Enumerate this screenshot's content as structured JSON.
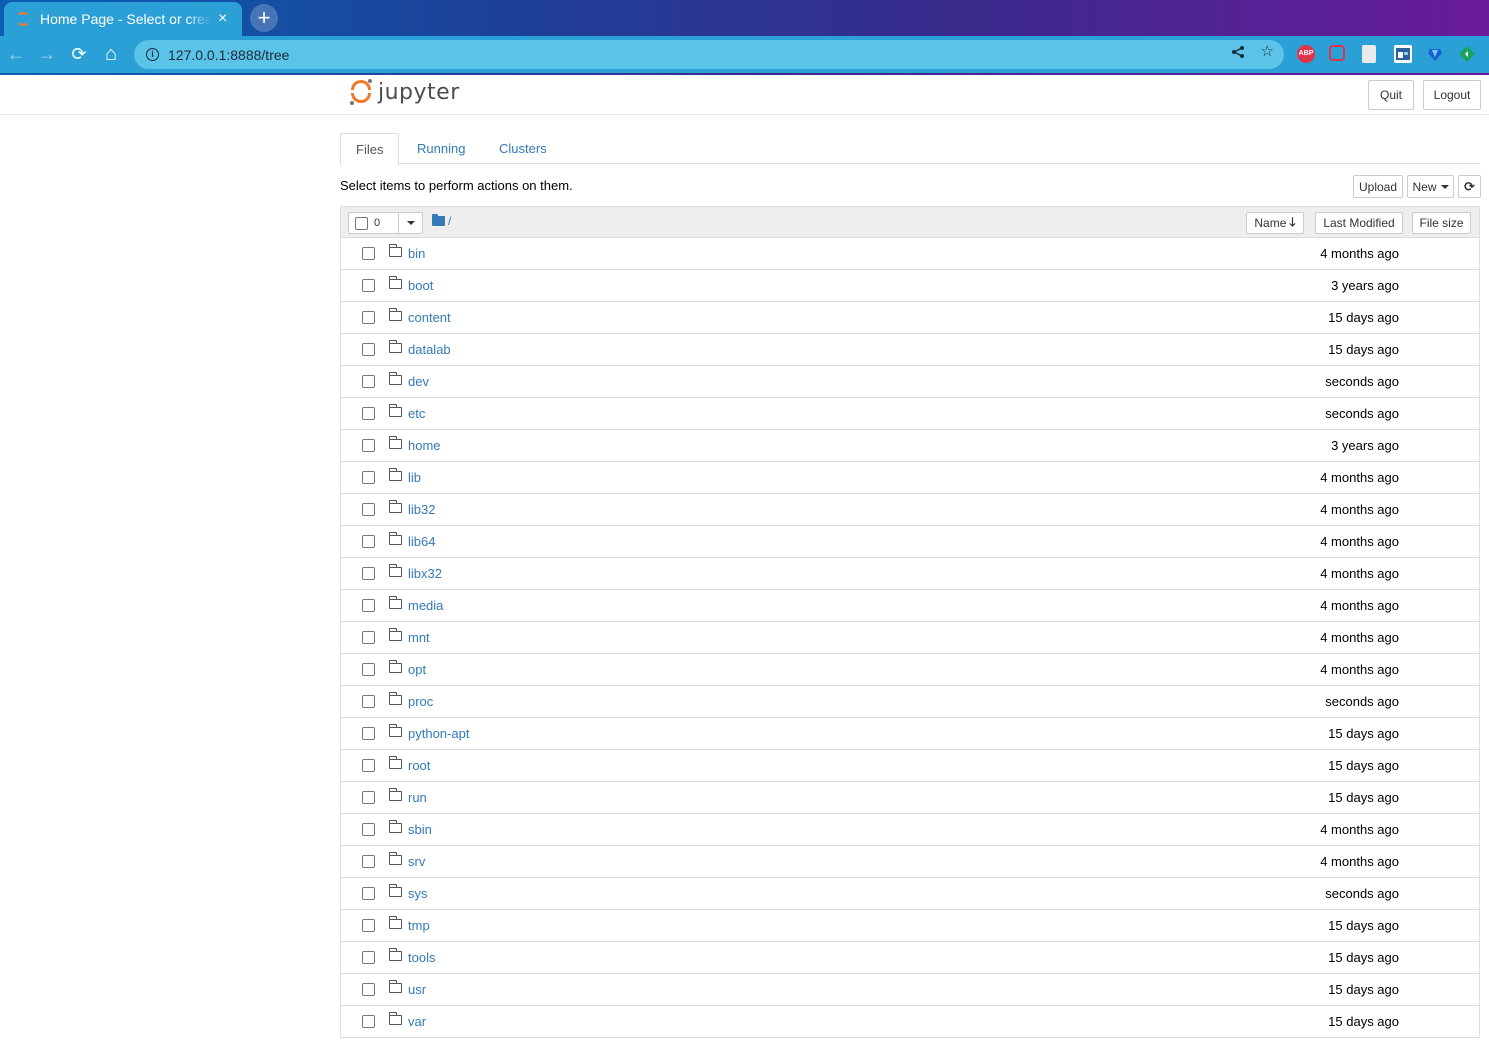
{
  "browser": {
    "tab_title": "Home Page - Select or create a notebook",
    "tab_close": "×",
    "new_tab": "+",
    "url": "127.0.0.1:8888/tree",
    "info": "i",
    "back": "←",
    "forward": "→",
    "reload": "⟳",
    "home": "⌂",
    "share": "⋖",
    "star": "☆",
    "extensions": {
      "abp": "ABP"
    }
  },
  "header": {
    "logo_text": "jupyter",
    "quit_label": "Quit",
    "logout_label": "Logout"
  },
  "tabs": [
    {
      "label": "Files"
    },
    {
      "label": "Running"
    },
    {
      "label": "Clusters"
    }
  ],
  "toolbar": {
    "hint": "Select items to perform actions on them.",
    "upload_label": "Upload",
    "new_label": "New",
    "refresh_icon": "⟳"
  },
  "list_header": {
    "selected_count": "0",
    "breadcrumb": "/",
    "sort_name": "Name",
    "sort_name_arrow": "🡓",
    "sort_modified": "Last Modified",
    "sort_size": "File size"
  },
  "files": [
    {
      "name": "bin",
      "modified": "4 months ago"
    },
    {
      "name": "boot",
      "modified": "3 years ago"
    },
    {
      "name": "content",
      "modified": "15 days ago"
    },
    {
      "name": "datalab",
      "modified": "15 days ago"
    },
    {
      "name": "dev",
      "modified": "seconds ago"
    },
    {
      "name": "etc",
      "modified": "seconds ago"
    },
    {
      "name": "home",
      "modified": "3 years ago"
    },
    {
      "name": "lib",
      "modified": "4 months ago"
    },
    {
      "name": "lib32",
      "modified": "4 months ago"
    },
    {
      "name": "lib64",
      "modified": "4 months ago"
    },
    {
      "name": "libx32",
      "modified": "4 months ago"
    },
    {
      "name": "media",
      "modified": "4 months ago"
    },
    {
      "name": "mnt",
      "modified": "4 months ago"
    },
    {
      "name": "opt",
      "modified": "4 months ago"
    },
    {
      "name": "proc",
      "modified": "seconds ago"
    },
    {
      "name": "python-apt",
      "modified": "15 days ago"
    },
    {
      "name": "root",
      "modified": "15 days ago"
    },
    {
      "name": "run",
      "modified": "15 days ago"
    },
    {
      "name": "sbin",
      "modified": "4 months ago"
    },
    {
      "name": "srv",
      "modified": "4 months ago"
    },
    {
      "name": "sys",
      "modified": "seconds ago"
    },
    {
      "name": "tmp",
      "modified": "15 days ago"
    },
    {
      "name": "tools",
      "modified": "15 days ago"
    },
    {
      "name": "usr",
      "modified": "15 days ago"
    },
    {
      "name": "var",
      "modified": "15 days ago"
    }
  ]
}
